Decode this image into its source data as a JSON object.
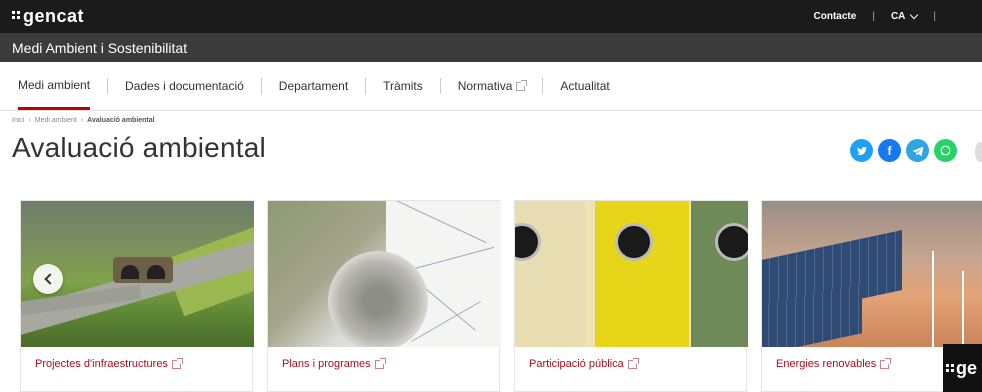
{
  "header": {
    "logo_text": "gencat",
    "contact_label": "Contacte",
    "language_label": "CA"
  },
  "site": {
    "title": "Medi Ambient i Sostenibilitat"
  },
  "nav": {
    "items": [
      {
        "label": "Medi ambient"
      },
      {
        "label": "Dades i documentació"
      },
      {
        "label": "Departament"
      },
      {
        "label": "Tràmits"
      },
      {
        "label": "Normativa"
      },
      {
        "label": "Actualitat"
      }
    ]
  },
  "breadcrumb": {
    "items": [
      "Inici",
      "Medi ambient",
      "Avaluació ambiental"
    ]
  },
  "page": {
    "title": "Avaluació ambiental"
  },
  "share": {
    "icons": [
      "twitter-icon",
      "facebook-icon",
      "telegram-icon",
      "whatsapp-icon"
    ]
  },
  "cards": [
    {
      "label": "Projectes d'infraestructures"
    },
    {
      "label": "Plans i programes"
    },
    {
      "label": "Participació pública"
    },
    {
      "label": "Energies renovables"
    }
  ],
  "overlay": {
    "brand_text": "ge"
  },
  "colors": {
    "topbar": "#1b1b1b",
    "sitebar": "#3b3b3b",
    "accent": "#c00000",
    "card_link": "#b00a1a"
  }
}
